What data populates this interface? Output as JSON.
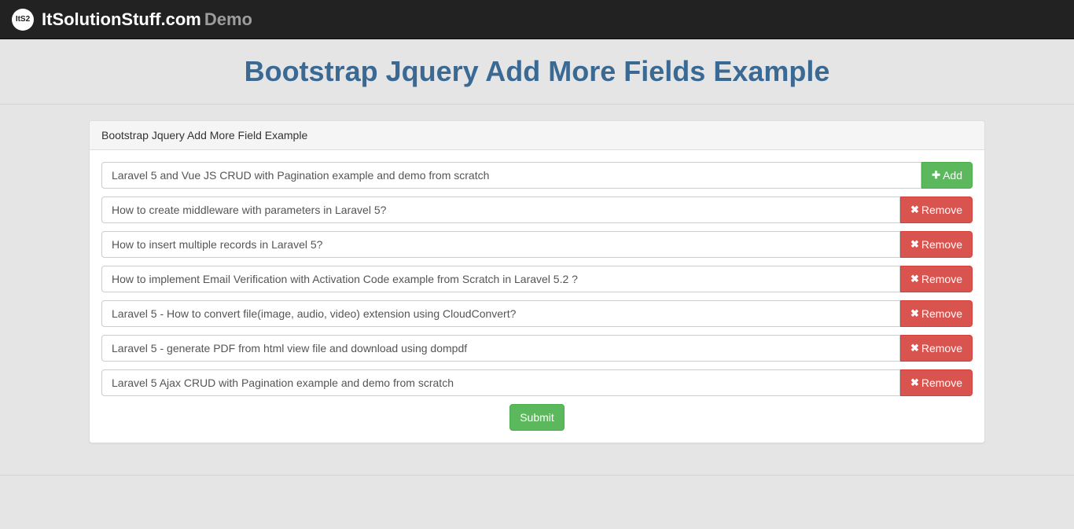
{
  "navbar": {
    "logo_text": "ItS2",
    "brand": "ItSolutionStuff.com",
    "demo": "Demo"
  },
  "page_title": "Bootstrap Jquery Add More Fields Example",
  "panel": {
    "heading": "Bootstrap Jquery Add More Field Example",
    "add_button": "Add",
    "remove_button": "Remove",
    "submit_button": "Submit",
    "fields": [
      {
        "value": "Laravel 5 and Vue JS CRUD with Pagination example and demo from scratch",
        "action": "add"
      },
      {
        "value": "How to create middleware with parameters in Laravel 5?",
        "action": "remove"
      },
      {
        "value": "How to insert multiple records in Laravel 5?",
        "action": "remove"
      },
      {
        "value": "How to implement Email Verification with Activation Code example from Scratch in Laravel 5.2 ?",
        "action": "remove"
      },
      {
        "value": "Laravel 5 - How to convert file(image, audio, video) extension using CloudConvert?",
        "action": "remove"
      },
      {
        "value": "Laravel 5 - generate PDF from html view file and download using dompdf",
        "action": "remove"
      },
      {
        "value": "Laravel 5 Ajax CRUD with Pagination example and demo from scratch",
        "action": "remove"
      }
    ]
  }
}
